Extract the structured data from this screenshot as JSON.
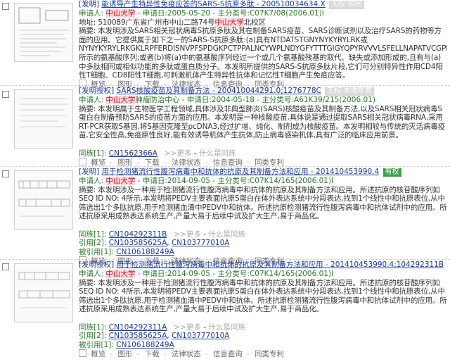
{
  "records": [
    {
      "type": "[发明]",
      "title": "能诱导产生特异性免疫应答的SARS-S抗原多肽 - 200510034634.X",
      "status_tag": "无权-驳回",
      "applicant_label": "申请人:",
      "applicant": "中山大学",
      "date_label": "申请日:",
      "date": "2005-05-20",
      "ipc_label": "主分类号:",
      "ipc": "C07K7/08(2006.01)I",
      "address": "地址: 510089广东省广州市中山二路74号",
      "address_hl": "中山大学",
      "address_tail": "北校区",
      "abstract": "摘要: 本发明涉及SARS相关冠状病毒S抗原多肽及其在制备SARS疫苗、SARS诊断试剂以及治疗SARS的药物等方面的应用。它提供属于如下之一的SARS-S抗原多肽:(a)具有NTDATSTGNYNYKYRYLRK或NYNYKYRYLRKGKLRPFERDISNVPFSPDGKPCTPPALNCYWPLNDYGFYTTTGIGYQPYRVVVLSFELLNAPATVCGPKL所示的氨基酸序列;或者(b)将(a)中的氨基酸序列经过一个或几个氨基酸残基的取代、缺失或添加形成的,且有与(a)中多肽相同或相似功能的多肽或蛋白质分子。本发明所提供的SARS-S抗原多肽片段,它们可分别特异性作用CD4阳性T细胞、CD8阳性T细胞,可刺激机体产生特异性抗体和记忆性T细胞产生免疫应答。",
      "actions": [
        "概览",
        "图形",
        "下载",
        "法律状态",
        "信息查询",
        "同类专利"
      ]
    },
    {
      "type": "[发明授权]",
      "title": "SARS核酸疫苗及其制备方法 - 200410044291.0;1276778C",
      "status_tag": "无权-未缴年费",
      "applicant_label": "申请人:",
      "applicant": "中山大学",
      "applicant_tail": "肿瘤防治中心",
      "date_label": "申请日:",
      "date": "2004-05-18",
      "ipc_label": "主分类号:",
      "ipc": "A61K39/215(2006.01)",
      "abstract": "摘要: 本发明属于生物医学工程领域,具体涉及非典型肺炎(SARS)核酸疫苗及其制备方法,以及SARS相关冠状病毒S蛋白在制备预防SARS的疫苗方面的应用。本发明是一种核酸疫苗,具体说是通过提取SARS相关冠状病毒RNA,采用RT-PCR获取S基因,将S基因克隆至pcDNA3,经过扩增、纯化、制剂成为核酸疫苗。本发明相较与传统的灭活病毒疫苗,它安全性高,免疫原性良好,能有效诱导机体产生抗体,防止病毒感染机体,具有广泛的临床应用前景。",
      "same_family_label": "同族[1]:",
      "same_family": "CN1562366A",
      "more": ">>更多",
      "what_same": "什么是同族",
      "actions": [
        "概览",
        "图形",
        "下载",
        "法律状态",
        "信息查询",
        "同类专利"
      ]
    },
    {
      "type": "[发明]",
      "title": "用于检测猪流行性腹泻病毒中和抗体的抗原及其制备方法和应用 - 201410453990.4",
      "status_tag": "有权",
      "applicant_label": "申请人:",
      "applicant": "中山大学",
      "date_label": "申请日:",
      "date": "2014-09-05",
      "ipc_label": "主分类号:",
      "ipc": "C07K14/165(2006.01)I",
      "abstract": "摘要: 本发明涉及一种用于检测猪流行性腹泻病毒中和抗体的抗原及其制备方法和应用。所述抗原的核苷酸序列如SEQ ID NO: 4所示,本发明将PEDV主要表面抗原S蛋白在体外表达系统中分段表达,找到1个线性中和抗原表位,从中筛选出1个多肽抗原,用于检测猪血清中PEDV中和抗体。所述抗原检测猪流行性腹泻病毒中和抗体试剂中的应用。所述抗原采用成熟表达系统生产,产量大易于后续中试及扩大生产,易于商品化。",
      "same_family_label": "同族[1]:",
      "same_family": "CN104292311B",
      "more": ">>更多",
      "what_same": "什么是同族",
      "cited_label": "引用[2]:",
      "cited": [
        "CN103585625A",
        "CN103777010A"
      ],
      "citedby_label": "被引用[1]:",
      "citedby": "CN106188249A",
      "actions": [
        "概览",
        "图形",
        "下载",
        "法律状态",
        "信息查询",
        "同类专利"
      ]
    },
    {
      "type": "[发明授权]",
      "title": "用于检测猪流行性腹泻病毒中和抗体的抗原及其制备方法和应用 - 201410453990.4;104292311B",
      "status_tag": "有权",
      "applicant_label": "申请人:",
      "applicant": "中山大学",
      "date_label": "申请日:",
      "date": "2014-09-05",
      "ipc_label": "主分类号:",
      "ipc": "C07K14/165(2006.01)I",
      "abstract": "摘要: 本发明涉及一种用于检测猪流行性腹泻病毒中和抗体的抗原及其制备方法和应用。所述抗原的核苷酸序列如SEQ ID NO: 4所示,本发明将PEDV主要表面抗原S蛋白在体外表达系统中分段表达,找到1个线性中和抗原表位,从中筛选出1个多肽抗原,用于检测猪血清中PEDV中和抗体。所述抗原检测猪流行性腹泻病毒中和抗体试剂中的应用。所述抗原采用成熟表达系统生产,产量大易于后续中试及扩大生产,易于商品化。",
      "same_family_label": "同族[1]:",
      "same_family": "CN104292311A",
      "more": ">>更多",
      "what_same": "什么是同族",
      "cited_label": "引用[2]:",
      "cited": [
        "CN103585625A",
        "CN103777010A"
      ],
      "citedby_label": "被引用[1]:",
      "citedby": "CN106188249A",
      "actions": [
        "概览",
        "图形",
        "下载",
        "法律状态",
        "信息查询",
        "同类专利"
      ]
    }
  ]
}
